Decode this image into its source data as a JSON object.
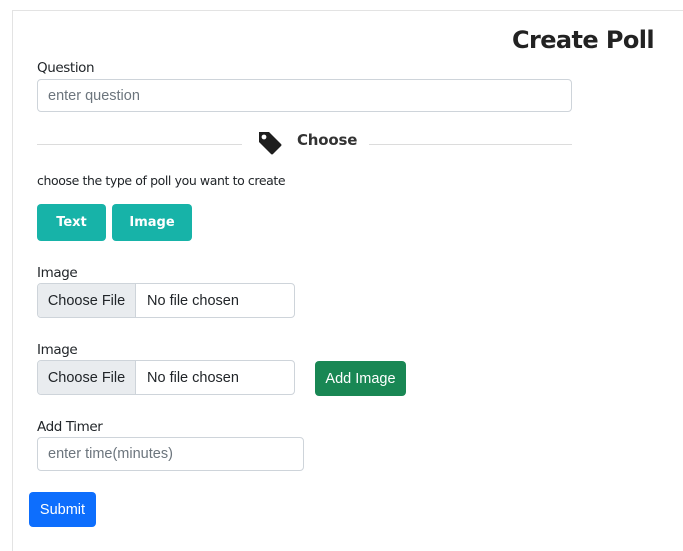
{
  "page": {
    "title": "Create Poll"
  },
  "question": {
    "label": "Question",
    "placeholder": "enter question"
  },
  "divider": {
    "label": "Choose",
    "icon": "tag-icon"
  },
  "poll_type": {
    "prompt": "choose the type of poll you want to create",
    "options": [
      {
        "label": "Text"
      },
      {
        "label": "Image"
      }
    ]
  },
  "images": [
    {
      "label": "Image",
      "button_label": "Choose File",
      "status": "No file chosen"
    },
    {
      "label": "Image",
      "button_label": "Choose File",
      "status": "No file chosen"
    }
  ],
  "add_image": {
    "label": "Add Image"
  },
  "timer": {
    "label": "Add Timer",
    "placeholder": "enter time(minutes)"
  },
  "submit": {
    "label": "Submit"
  },
  "colors": {
    "teal": "#17b3a8",
    "green": "#198754",
    "blue": "#0d6efd",
    "file_button_bg": "#e9ecef",
    "border": "#ced4da"
  }
}
